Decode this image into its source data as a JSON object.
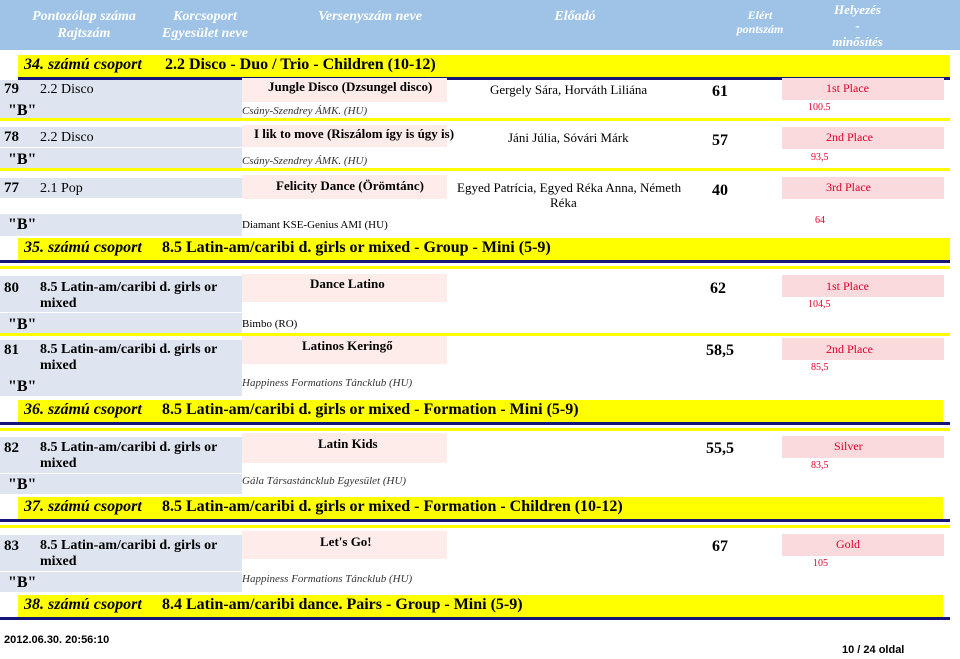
{
  "header": {
    "col1_line1": "Pontozólap száma",
    "col1_line2": "Rajtszám",
    "col2_line1": "Korcsoport",
    "col2_line2": "Egyesület neve",
    "col3": "Versenyszám neve",
    "col4": "Előadó",
    "col5_line1": "Elért",
    "col5_line2": "pontszám",
    "col6_line1": "Helyezés",
    "col6_line2": "-",
    "col6_line3": "minősítés"
  },
  "groups": [
    {
      "num": "34. számú csoport",
      "title": "2.2 Disco - Duo / Trio - Children (10-12)"
    },
    {
      "num": "35. számú csoport",
      "title": "8.5 Latin-am/caribi d. girls or  mixed - Group - Mini (5-9)"
    },
    {
      "num": "36. számú csoport",
      "title": "8.5 Latin-am/caribi d. girls or  mixed - Formation - Mini (5-9)"
    },
    {
      "num": "37. számú csoport",
      "title": "8.5 Latin-am/caribi d. girls or  mixed - Formation - Children (10-12)"
    },
    {
      "num": "38. számú csoport",
      "title": "8.4 Latin-am/caribi dance. Pairs - Group - Mini (5-9)"
    }
  ],
  "entries": [
    {
      "no": "79",
      "cat": "2.2 Disco",
      "cls": "\"B\"",
      "title": "Jungle Disco (Dzsungel disco)",
      "club": "Csány-Szendrey ÁMK. (HU)",
      "performer": "Gergely Sára, Horváth Liliána",
      "points": "61",
      "place": "1st Place",
      "score": "100.5"
    },
    {
      "no": "78",
      "cat": "2.2 Disco",
      "cls": "\"B\"",
      "title": "I lik to move (Riszálom így is úgy is)",
      "club": "Csány-Szendrey ÁMK. (HU)",
      "performer": "Jáni Júlia, Sóvári Márk",
      "points": "57",
      "place": "2nd Place",
      "score": "93,5"
    },
    {
      "no": "77",
      "cat": "2.1 Pop",
      "cls": "\"B\"",
      "title": "Felicity Dance (Örömtánc)",
      "club": "Diamant KSE-Genius AMI (HU)",
      "performer_l1": "Egyed Patrícia, Egyed Réka Anna, Németh",
      "performer_l2": "Réka",
      "points": "40",
      "place": "3rd Place",
      "score": "64"
    },
    {
      "no": "80",
      "cat_l1": "8.5 Latin-am/caribi d. girls or",
      "cat_l2": "mixed",
      "cls": "\"B\"",
      "title": "Dance Latino",
      "club": "Bimbo (RO)",
      "points": "62",
      "place": "1st Place",
      "score": "104,5"
    },
    {
      "no": "81",
      "cat_l1": "8.5 Latin-am/caribi d. girls or",
      "cat_l2": "mixed",
      "cls": "\"B\"",
      "title": "Latinos Keringő",
      "club": "Happiness Formations Táncklub (HU)",
      "points": "58,5",
      "place": "2nd Place",
      "score": "85,5"
    },
    {
      "no": "82",
      "cat_l1": "8.5 Latin-am/caribi d. girls or",
      "cat_l2": "mixed",
      "cls": "\"B\"",
      "title": "Latin Kids",
      "club": "Gála Társastáncklub Egyesület (HU)",
      "points": "55,5",
      "place": "Silver",
      "score": "83,5"
    },
    {
      "no": "83",
      "cat_l1": "8.5 Latin-am/caribi d. girls or",
      "cat_l2": "mixed",
      "cls": "\"B\"",
      "title": "Let's Go!",
      "club": "Happiness Formations Táncklub (HU)",
      "points": "67",
      "place": "Gold",
      "score": "105"
    }
  ],
  "footer": {
    "timestamp": "2012.06.30. 20:56:10",
    "page": "10 / 24 oldal"
  }
}
